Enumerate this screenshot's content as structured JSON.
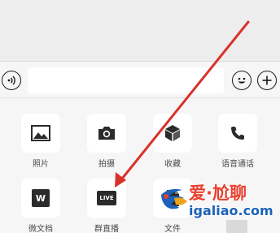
{
  "input_bar": {
    "voice_icon": "voice-icon",
    "emoji_icon": "emoji-icon",
    "plus_icon": "plus-icon",
    "text_value": ""
  },
  "tools": [
    {
      "label": "照片",
      "icon": "photo-icon"
    },
    {
      "label": "拍摄",
      "icon": "camera-icon"
    },
    {
      "label": "收藏",
      "icon": "favorites-cube-icon"
    },
    {
      "label": "语音通话",
      "icon": "phone-icon"
    },
    {
      "label": "微文档",
      "icon": "w-doc-icon",
      "glyph": "W"
    },
    {
      "label": "群直播",
      "icon": "live-icon",
      "glyph": "LIVE"
    },
    {
      "label": "文件",
      "icon": "file-icon"
    }
  ],
  "watermark": {
    "brand_cn": "爱·尬聊",
    "url": "igaliao.com"
  },
  "colors": {
    "arrow": "#d9322b",
    "watermark_red": "#e8402f",
    "watermark_blue": "#1b62b8"
  }
}
